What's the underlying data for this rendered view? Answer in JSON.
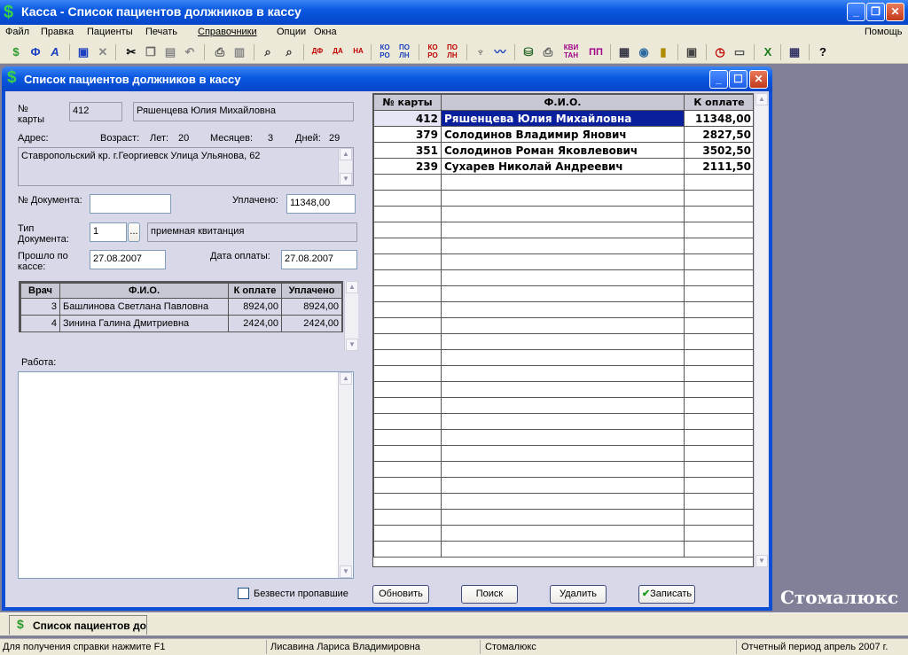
{
  "window": {
    "title": "Касса - Список пациентов должников в кассу",
    "minimize": "_",
    "restore": "❐",
    "close": "✕"
  },
  "menu": [
    "Файл",
    "Правка",
    "Пациенты",
    "Печать",
    "Справочники",
    "Опции",
    "Окна"
  ],
  "menu_help": "Помощь",
  "toolbar": {
    "icons": [
      "dollar-icon",
      "f-icon",
      "a-icon",
      "save-icon",
      "cancel-icon",
      "cut-icon",
      "copy-icon",
      "paste-icon",
      "undo-icon",
      "print-icon",
      "preview-icon",
      "find-icon",
      "find-next-icon"
    ],
    "text_buttons": [
      "ДФ",
      "ДА",
      "НА",
      "КО РО",
      "ПО ЛН",
      "КО РО",
      "ПО ЛН",
      "КВИ ТАН",
      "ПП"
    ]
  },
  "child_window": {
    "title": "Список пациентов должников в кассу"
  },
  "form": {
    "card_label": "№ карты",
    "card_value": "412",
    "patient_name": "Ряшенцева Юлия Михайловна",
    "address_label": "Адрес:",
    "age_label": "Возраст:",
    "years_label": "Лет:",
    "years_value": "20",
    "months_label": "Месяцев:",
    "months_value": "3",
    "days_label": "Дней:",
    "days_value": "29",
    "address_value": "Ставропольский кр. г.Георгиевск Улица Ульянова, 62",
    "doc_number_label": "№ Документа:",
    "doc_number_value": "",
    "paid_label": "Уплачено:",
    "paid_value": "11348,00",
    "doc_type_label": "Тип Документа:",
    "doc_type_code": "1",
    "doc_type_btn": "...",
    "doc_type_name": "приемная квитанция",
    "passed_label": "Прошло по кассе:",
    "passed_value": "27.08.2007",
    "pay_date_label": "Дата оплаты:",
    "pay_date_value": "27.08.2007",
    "work_label": "Работа:",
    "work_value": ""
  },
  "doctors_grid": {
    "headers": [
      "Врач",
      "Ф.И.О.",
      "К оплате",
      "Уплачено"
    ],
    "rows": [
      {
        "id": "3",
        "name": "Башлинова Светлана Павловна",
        "to_pay": "8924,00",
        "paid": "8924,00"
      },
      {
        "id": "4",
        "name": "Зинина Галина Дмитриевна",
        "to_pay": "2424,00",
        "paid": "2424,00"
      }
    ]
  },
  "patients_grid": {
    "headers": [
      "№ карты",
      "Ф.И.О.",
      "К оплате"
    ],
    "rows": [
      {
        "card": "412",
        "name": "Ряшенцева Юлия Михайловна",
        "amount": "11348,00"
      },
      {
        "card": "379",
        "name": "Солодинов Владимир Янович",
        "amount": "2827,50"
      },
      {
        "card": "351",
        "name": "Солодинов Роман Яковлевович",
        "amount": "3502,50"
      },
      {
        "card": "239",
        "name": "Сухарев Николай Андреевич",
        "amount": "2111,50"
      }
    ]
  },
  "buttons": {
    "skip_label": "Безвести пропавшие",
    "refresh": "Обновить",
    "search": "Поиск",
    "delete": "Удалить",
    "save": "Записать"
  },
  "brand": "Стомалюкс",
  "mdi_tab": "Список пациентов до",
  "status": {
    "help": "Для получения справки нажмите F1",
    "user": "Лисавина Лариса Владимировна",
    "app": "Стомалюкс",
    "period": "Отчетный период апрель 2007 г."
  },
  "colors": {
    "title_blue": "#0a58e0",
    "selection": "#0a1f9c",
    "panel": "#d8d8e8"
  }
}
